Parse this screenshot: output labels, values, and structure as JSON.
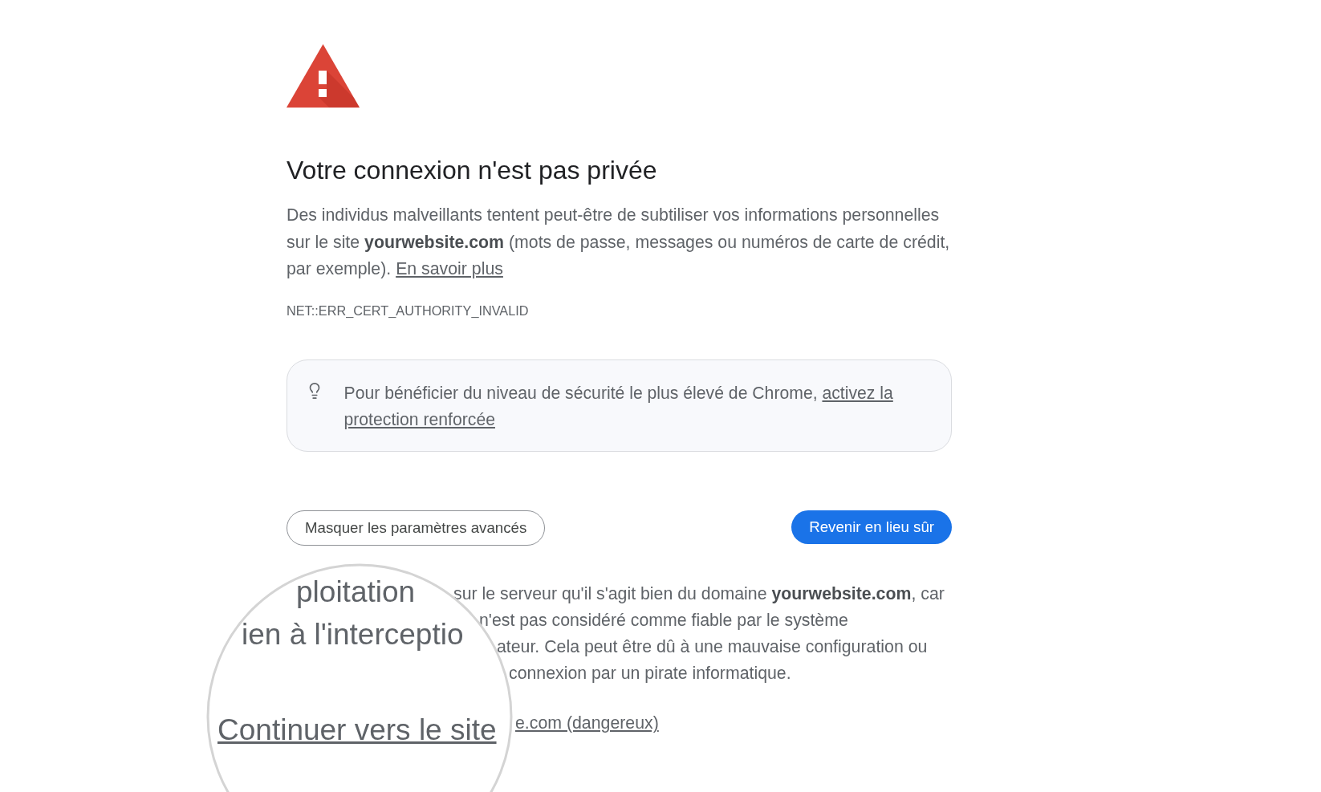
{
  "title": "Votre connexion n'est pas privée",
  "intro": {
    "text": "Des individus malveillants tentent peut-être de subtiliser vos informations personnelles sur le site **yourwebsite.com** (mots de passe, messages ou numéros de carte de crédit, par exemple).",
    "link": "En savoir plus"
  },
  "error_code": "NET::ERR_CERT_AUTHORITY_INVALID",
  "tip": {
    "text": "Pour bénéficier du niveau de sécurité le plus élevé de Chrome,",
    "link_lines": [
      "activez la",
      "protection renforcée"
    ]
  },
  "buttons": [
    {
      "label": "Masquer les paramètres avancés",
      "kind": "secondary"
    },
    {
      "label": "Revenir en lieu sûr",
      "kind": "primary"
    }
  ],
  "details": {
    "lines": [
      "sur le serveur qu'il s'agit bien du domaine **yourwebsite.com**, car",
      "n'est pas considéré comme fiable par le système",
      "ateur. Cela peut être dû à une mauvaise configuration ou",
      "connexion par un pirate informatique."
    ],
    "link": "e.com (dangereux)"
  },
  "magnifier": {
    "lines": [
      {
        "kind": "text",
        "text": "ploitation"
      },
      {
        "kind": "text",
        "text": "ien à l'interceptio"
      },
      {
        "kind": "link",
        "text": "Continuer vers le site"
      }
    ]
  }
}
